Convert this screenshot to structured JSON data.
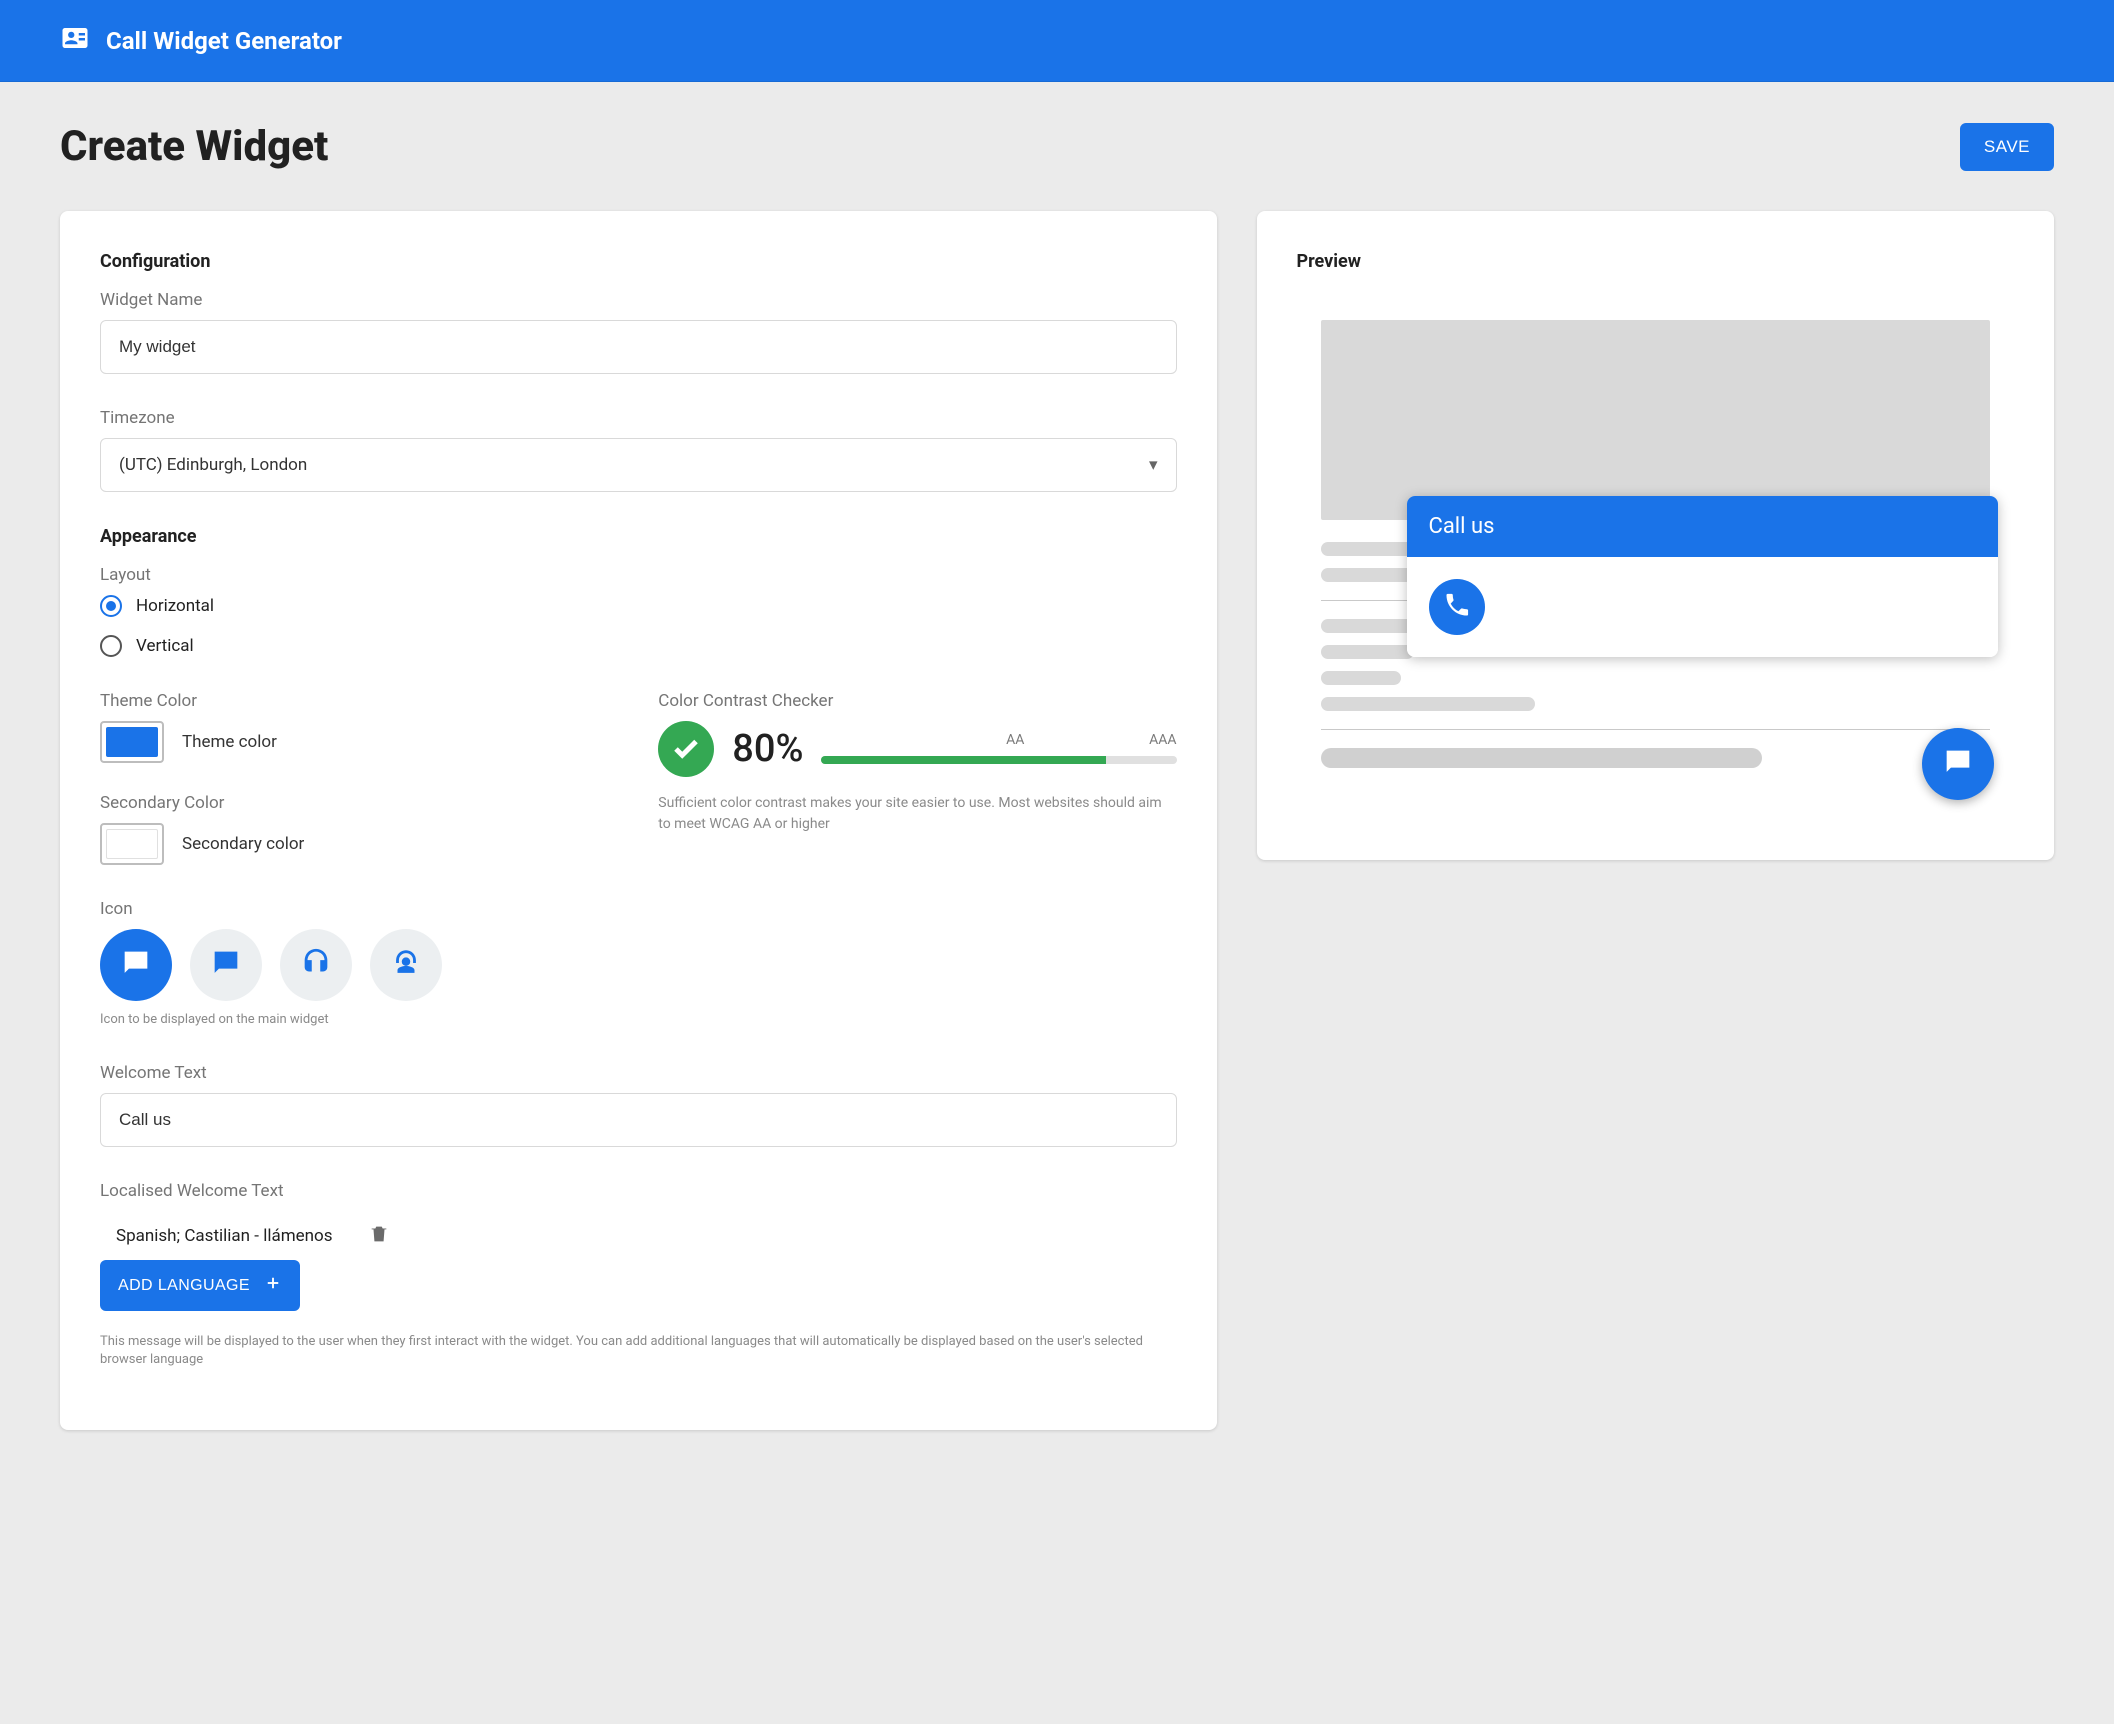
{
  "header": {
    "brand": "Call Widget Generator"
  },
  "page": {
    "title": "Create Widget",
    "save_label": "SAVE"
  },
  "config": {
    "section_title": "Configuration",
    "widget_name_label": "Widget Name",
    "widget_name_value": "My widget",
    "timezone_label": "Timezone",
    "timezone_value": "(UTC) Edinburgh, London"
  },
  "appearance": {
    "section_title": "Appearance",
    "layout_label": "Layout",
    "layout_options": {
      "horizontal": "Horizontal",
      "vertical": "Vertical"
    },
    "layout_selected": "horizontal",
    "theme_color_label": "Theme Color",
    "theme_color_name": "Theme color",
    "theme_color_hex": "#1a73e8",
    "secondary_color_label": "Secondary Color",
    "secondary_color_name": "Secondary color",
    "secondary_color_hex": "#ffffff",
    "contrast": {
      "label": "Color Contrast Checker",
      "percent_text": "80%",
      "percent_value": 80,
      "tick_aa": "AA",
      "tick_aaa": "AAA",
      "help": "Sufficient color contrast makes your site easier to use. Most websites should aim to meet WCAG AA or higher"
    },
    "icon_label": "Icon",
    "icon_help": "Icon to be displayed on the main widget",
    "icon_choices": [
      "message",
      "chat-dots",
      "headset",
      "agent"
    ],
    "icon_selected": "message",
    "welcome_label": "Welcome Text",
    "welcome_value": "Call us",
    "localised_label": "Localised Welcome Text",
    "localised_items": [
      {
        "language": "Spanish; Castilian",
        "text": "llámenos"
      }
    ],
    "add_language_label": "ADD LANGUAGE",
    "localised_help": "This message will be displayed to the user when they first interact with the widget. You can add additional languages that will automatically be displayed based on the user's selected browser language"
  },
  "preview": {
    "section_title": "Preview",
    "popup_title": "Call us"
  }
}
